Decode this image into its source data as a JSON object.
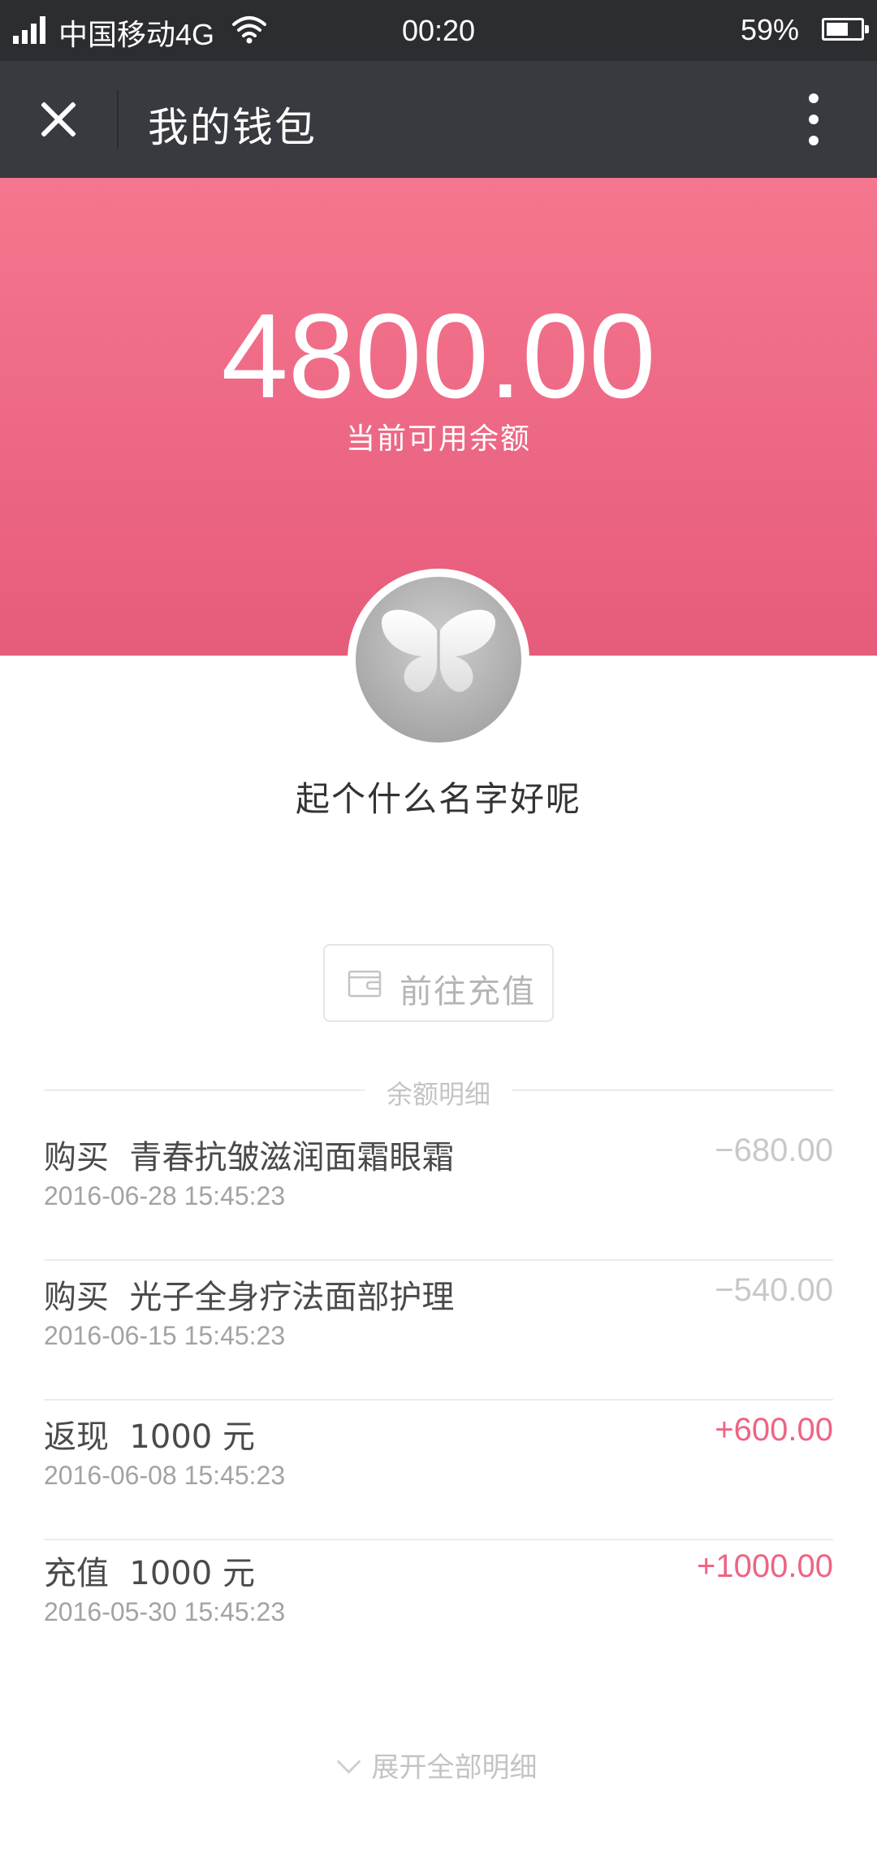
{
  "status_bar": {
    "carrier": "中国移动4G",
    "time": "00:20",
    "battery_percent": "59%",
    "battery_level": 0.59,
    "icons": [
      "signal-icon",
      "wifi-icon",
      "battery-icon"
    ]
  },
  "app_bar": {
    "title": "我的钱包",
    "close_icon": "close-icon",
    "more_icon": "more-vertical-icon"
  },
  "balance": {
    "amount": "4800.00",
    "label": "当前可用余额"
  },
  "user": {
    "avatar_icon": "butterfly-icon",
    "name": "起个什么名字好呢"
  },
  "recharge": {
    "icon": "wallet-icon",
    "label": "前往充值"
  },
  "details": {
    "title": "余额明细",
    "transactions": [
      {
        "description": "购买  青春抗皱滋润面霜眼霜",
        "date": "2016-06-28 15:45:23",
        "amount": "−680.00",
        "type": "debit"
      },
      {
        "description": "购买  光子全身疗法面部护理",
        "date": "2016-06-15 15:45:23",
        "amount": "−540.00",
        "type": "debit"
      },
      {
        "description": "返现  1000 元",
        "date": "2016-06-08 15:45:23",
        "amount": "+600.00",
        "type": "credit"
      },
      {
        "description": "充值  1000 元",
        "date": "2016-05-30 15:45:23",
        "amount": "+1000.00",
        "type": "credit"
      }
    ],
    "expand_label": "展开全部明细"
  },
  "colors": {
    "status_bar_bg": "#2c2d31",
    "app_bar_bg": "#393a3f",
    "balance_gradient_top": "#f5768f",
    "balance_gradient_bottom": "#e65c7b",
    "credit_amount": "#ee6483",
    "debit_amount": "#c8c8c8"
  }
}
